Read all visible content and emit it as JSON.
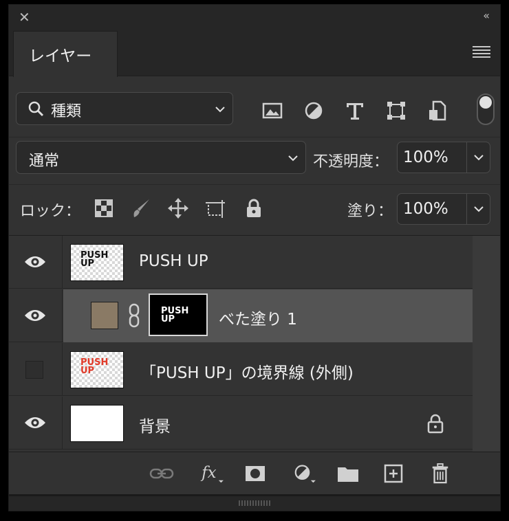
{
  "panel": {
    "close_glyph": "✕",
    "collapse_glyph": "‹‹",
    "tab_label": "レイヤー"
  },
  "filter": {
    "kind_label": "種類",
    "icons": [
      "image-filter-icon",
      "adjustment-filter-icon",
      "type-filter-icon",
      "shape-filter-icon",
      "smart-object-filter-icon"
    ],
    "filter_enabled": true
  },
  "blend": {
    "mode": "通常",
    "opacity_label": "不透明度：",
    "opacity_value": "100%"
  },
  "lock": {
    "label": "ロック：",
    "fill_label": "塗り：",
    "fill_value": "100%"
  },
  "layers": [
    {
      "name": "PUSH UP",
      "visible": true,
      "thumb_text_1": "PUSH",
      "thumb_text_2": "UP"
    },
    {
      "name": "べた塗り 1",
      "visible": true,
      "selected": true,
      "fill_color": "#8a7a65",
      "mask_text_1": "PUSH",
      "mask_text_2": "UP"
    },
    {
      "name": "「PUSH UP」の境界線 (外側)",
      "visible": false,
      "thumb_text_1": "PUSH",
      "thumb_text_2": "UP"
    },
    {
      "name": "背景",
      "visible": true,
      "locked": true
    }
  ],
  "colors": {
    "panel_bg": "#323232",
    "selected_row": "#545454",
    "stroke_red": "#e23b2a"
  }
}
